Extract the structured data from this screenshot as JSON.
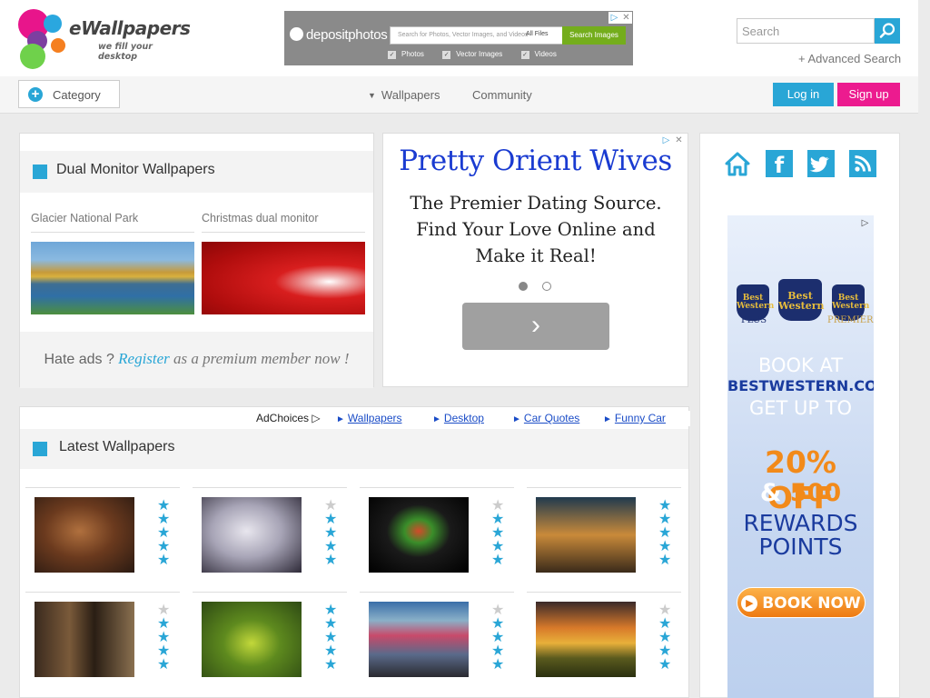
{
  "site": {
    "logo_text": "eWallpapers",
    "tagline": "we fill your desktop"
  },
  "top_ad": {
    "brand": "depositphotos",
    "search_placeholder": "Search for Photos, Vector Images, and Videos",
    "files_label": "All Files",
    "button": "Search Images",
    "options": [
      "Photos",
      "Vector Images",
      "Videos"
    ]
  },
  "search": {
    "placeholder": "Search",
    "advanced": "+ Advanced Search"
  },
  "nav": {
    "category": "Category",
    "wallpapers": "Wallpapers",
    "community": "Community",
    "login": "Log in",
    "signup": "Sign up"
  },
  "dual": {
    "title": "Dual Monitor Wallpapers",
    "items": [
      {
        "caption": "Glacier National Park"
      },
      {
        "caption": "Christmas dual monitor"
      }
    ],
    "footer": {
      "hate": "Hate ads ?",
      "register": "Register",
      "rest": "as a premium member now !"
    }
  },
  "dating_ad": {
    "title": "Pretty Orient Wives",
    "body": "The Premier Dating Source. Find Your Love Online and Make it Real!",
    "next": "›"
  },
  "ad_links": {
    "adchoices": "AdChoices",
    "links": [
      "Wallpapers",
      "Desktop",
      "Car Quotes",
      "Funny Car"
    ]
  },
  "latest": {
    "title": "Latest Wallpapers",
    "items": [
      {
        "rating": 5
      },
      {
        "rating": 4
      },
      {
        "rating": 4
      },
      {
        "rating": 5
      },
      {
        "rating": 4
      },
      {
        "rating": 5
      },
      {
        "rating": 4
      },
      {
        "rating": 4
      }
    ]
  },
  "social": [
    "home-icon",
    "facebook-icon",
    "twitter-icon",
    "rss-icon"
  ],
  "bw_ad": {
    "logo_1": "Best Western",
    "logo_1_sub": "PLUS",
    "logo_2": "Best Western",
    "logo_3": "Best Western",
    "logo_3_sub": "PREMIER",
    "book_at": "BOOK AT",
    "site": "BESTWESTERN.COM",
    "get_up_to": "GET UP TO",
    "off": "20% OFF",
    "amp": "&",
    "points_num": "500",
    "rewards_1": "REWARDS",
    "rewards_2": "POINTS",
    "cta": "BOOK NOW"
  },
  "colors": {
    "accent": "#29a6d6",
    "signup": "#ec1b8f",
    "ad_link": "#1a4cc7"
  }
}
